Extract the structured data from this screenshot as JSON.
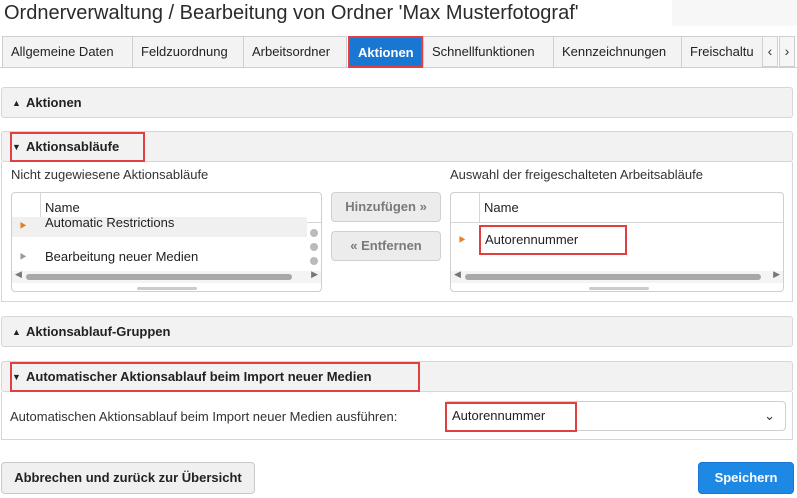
{
  "page": {
    "title": "Ordnerverwaltung / Bearbeitung von Ordner 'Max Musterfotograf'"
  },
  "tabs": [
    {
      "label": "Allgemeine Daten"
    },
    {
      "label": "Feldzuordnung"
    },
    {
      "label": "Arbeitsordner"
    },
    {
      "label": "Aktionen",
      "active": true
    },
    {
      "label": "Schnellfunktionen"
    },
    {
      "label": "Kennzeichnungen"
    },
    {
      "label": "Freischaltu"
    }
  ],
  "tab_nav": {
    "prev": "‹",
    "next": "›"
  },
  "sections": {
    "aktionen": {
      "title": "Aktionen",
      "expanded": false
    },
    "aktionsablaeufe": {
      "title": "Aktionsabläufe",
      "expanded": true,
      "left_label": "Nicht zugewiesene Aktionsabläufe",
      "right_label": "Auswahl der freigeschalteten Arbeitsabläufe",
      "column_name": "Name",
      "left_items": [
        {
          "label": "Automatic Restrictions",
          "highlighted": true
        },
        {
          "label": "Bearbeitung neuer Medien",
          "highlighted": false
        }
      ],
      "right_items": [
        {
          "label": "Autorennummer",
          "highlighted": true
        }
      ],
      "add_button": "Hinzufügen »",
      "remove_button": "« Entfernen"
    },
    "gruppen": {
      "title": "Aktionsablauf-Gruppen",
      "expanded": false
    },
    "import": {
      "title": "Automatischer Aktionsablauf beim Import neuer Medien",
      "expanded": true,
      "field_label": "Automatischen Aktionsablauf beim Import neuer Medien ausführen:",
      "selected_value": "Autorennummer"
    }
  },
  "footer": {
    "cancel_label": "Abbrechen und zurück zur Übersicht",
    "save_label": "Speichern"
  },
  "colors": {
    "accent": "#1976d2",
    "highlight_box": "#e04040",
    "arrow_active": "#e67e22",
    "arrow_inactive": "#999999"
  }
}
